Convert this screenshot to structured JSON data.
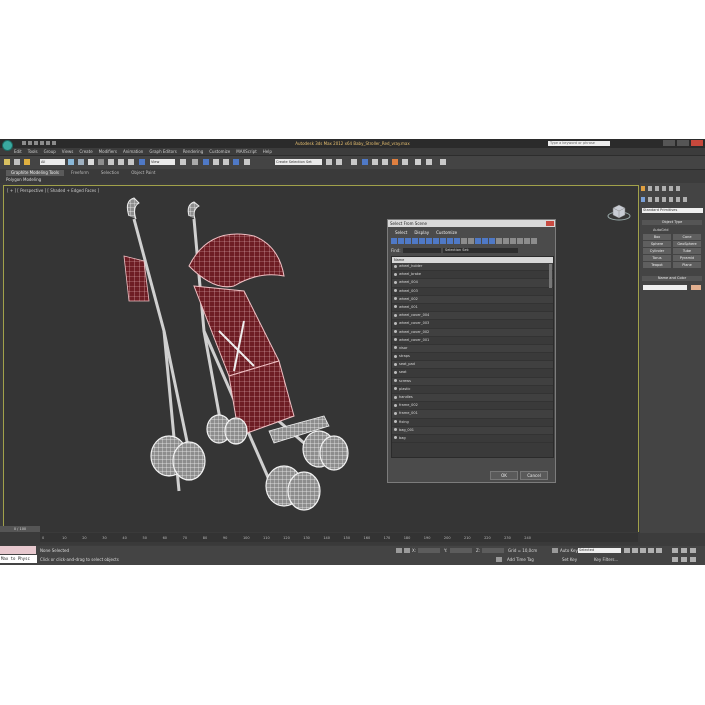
{
  "window": {
    "title": "Autodesk 3ds Max 2012 x64      Baby_Stroller_Red_vray.max",
    "search_placeholder": "Type a keyword or phrase"
  },
  "menu": [
    "Edit",
    "Tools",
    "Group",
    "Views",
    "Create",
    "Modifiers",
    "Animation",
    "Graph Editors",
    "Rendering",
    "Customize",
    "MAXScript",
    "Help"
  ],
  "toolbar": {
    "selection_filter": "All",
    "reference_coord": "View",
    "named_selection": "Create Selection Set"
  },
  "ribbon": {
    "tabs": [
      "Graphite Modeling Tools",
      "Freeform",
      "Selection",
      "Object Paint"
    ],
    "active_tab": "Graphite Modeling Tools",
    "sub_label": "Polygon Modeling"
  },
  "viewport": {
    "label": "[ + ] [ Perspective ] [ Shaded + Edged Faces ]"
  },
  "command_panel": {
    "dropdown": "Standard Primitives",
    "object_type_title": "Object Type",
    "autogrid": "AutoGrid",
    "primitives": [
      "Box",
      "Cone",
      "Sphere",
      "GeoSphere",
      "Cylinder",
      "Tube",
      "Torus",
      "Pyramid",
      "Teapot",
      "Plane"
    ],
    "name_color_title": "Name and Color"
  },
  "dialog": {
    "title": "Select From Scene",
    "menu": [
      "Select",
      "Display",
      "Customize"
    ],
    "find_label": "Find:",
    "selection_set_label": "Selection Set:",
    "column_header": "Name",
    "items": [
      "wheel_holder",
      "wheel_brake",
      "wheel_004",
      "wheel_003",
      "wheel_002",
      "wheel_001",
      "wheel_cover_004",
      "wheel_cover_003",
      "wheel_cover_002",
      "wheel_cover_001",
      "visor",
      "straps",
      "seat_pad",
      "seat",
      "screws",
      "plastic",
      "handles",
      "frame_002",
      "frame_001",
      "fixing",
      "bag_001",
      "bag"
    ],
    "ok_label": "OK",
    "cancel_label": "Cancel"
  },
  "timeline": {
    "slider": "0 / 100",
    "ticks": [
      "0",
      "10",
      "20",
      "30",
      "40",
      "50",
      "60",
      "70",
      "80",
      "90",
      "100",
      "110",
      "120",
      "130",
      "140",
      "150",
      "160",
      "170",
      "180",
      "190",
      "200",
      "210",
      "220",
      "230",
      "240"
    ]
  },
  "status": {
    "maxscript_text": "Max to Physc",
    "selection": "None Selected",
    "prompt": "Click or click-and-drag to select objects",
    "x_label": "X:",
    "y_label": "Y:",
    "z_label": "Z:",
    "grid": "Grid = 10,0cm",
    "add_time_tag": "Add Time Tag",
    "auto_key": "Auto Key",
    "selected": "Selected",
    "set_key": "Set Key",
    "key_filters": "Key Filters..."
  }
}
